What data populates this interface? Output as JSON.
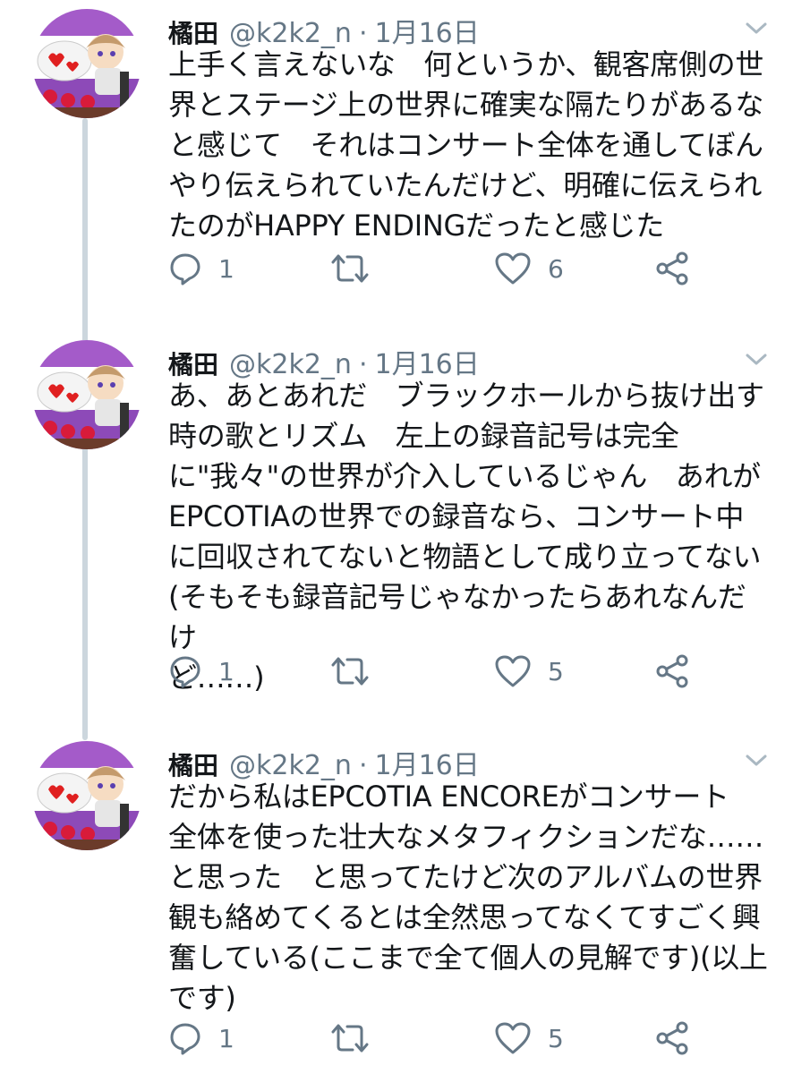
{
  "tweets": [
    {
      "name": "橘田",
      "handle": "@k2k2_n",
      "dot": "·",
      "date": "1月16日",
      "text": "上手く言えないな　何というか、観客席側の世\n界とステージ上の世界に確実な隔たりがあるな\nと感じて　それはコンサート全体を通してぼん\nやり伝えられていたんだけど、明確に伝えられ\nたのがHAPPY ENDINGだったと感じた",
      "replies": "1",
      "likes": "6"
    },
    {
      "name": "橘田",
      "handle": "@k2k2_n",
      "dot": "·",
      "date": "1月16日",
      "text": "あ、あとあれだ　ブラックホールから抜け出す\n時の歌とリズム　左上の録音記号は完全\nに\"我々\"の世界が介入しているじゃん　あれが\nEPCOTIAの世界での録音なら、コンサート中\nに回収されてないと物語として成り立ってない\n(そもそも録音記号じゃなかったらあれなんだけ\nど……)",
      "replies": "1",
      "likes": "5"
    },
    {
      "name": "橘田",
      "handle": "@k2k2_n",
      "dot": "·",
      "date": "1月16日",
      "text": "だから私はEPCOTIA ENCOREがコンサート\n全体を使った壮大なメタフィクションだな……\nと思った　と思ってたけど次のアルバムの世界\n観も絡めてくるとは全然思ってなくてすごく興\n奮している(ここまで全て個人の見解です)(以上\nです)",
      "replies": "1",
      "likes": "5"
    }
  ],
  "icons": {
    "avatar": "avatar-illustration",
    "more": "chevron-down-icon",
    "reply": "reply-icon",
    "retweet": "retweet-icon",
    "like": "heart-icon",
    "share": "share-icon"
  },
  "colors": {
    "text": "#14171a",
    "secondary": "#657786",
    "icon": "#657786",
    "thread_line": "#ccd6dd",
    "background": "#ffffff"
  }
}
